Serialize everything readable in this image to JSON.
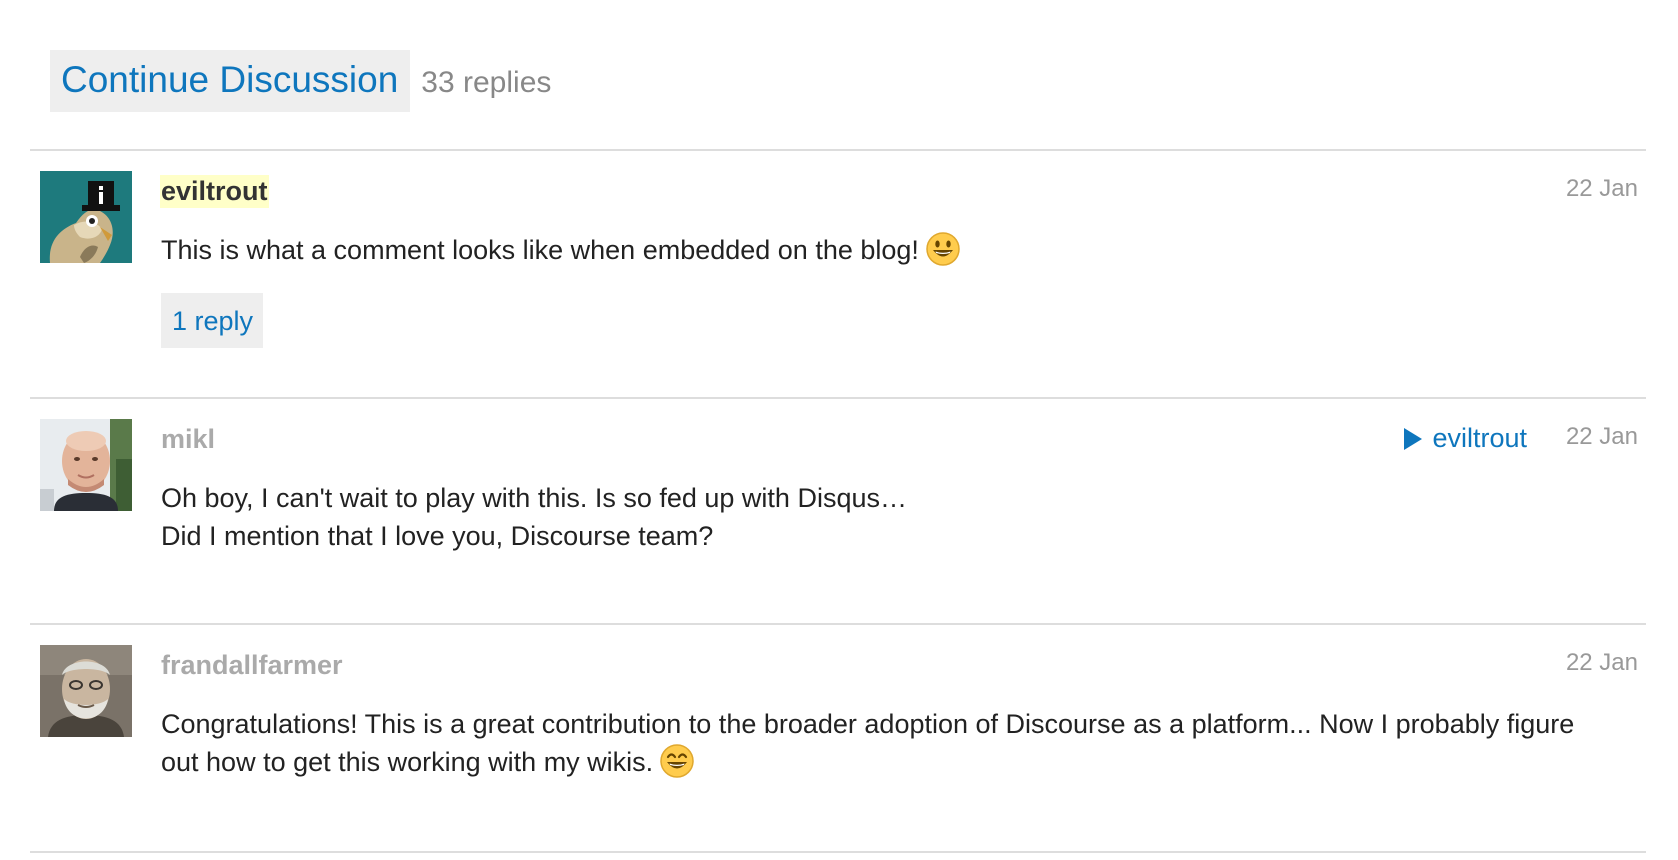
{
  "header": {
    "continue_label": "Continue Discussion",
    "replies_count": "33 replies"
  },
  "posts": [
    {
      "username": "eviltrout",
      "date": "22 Jan",
      "body_lines": [
        "This is what a comment looks like when embedded on the blog!"
      ],
      "emoji": "smiley",
      "reply_label": "1 reply",
      "avatar_icon": "owl-top-hat-avatar"
    },
    {
      "username": "mikl",
      "date": "22 Jan",
      "reply_to": "eviltrout",
      "body_lines": [
        "Oh boy, I can't wait to play with this. Is so fed up with Disqus…",
        "Did I mention that I love you, Discourse team?"
      ],
      "avatar_icon": "man-photo-avatar"
    },
    {
      "username": "frandallfarmer",
      "date": "22 Jan",
      "body_lines": [
        "Congratulations! This is a great contribution to the broader adoption of Discourse as a platform... Now I probably figure",
        "out how to get this working with my wikis."
      ],
      "emoji": "smile",
      "avatar_icon": "bearded-man-photo-avatar"
    }
  ],
  "colors": {
    "link": "#0e76bd",
    "button_bg": "#eeeeee",
    "highlight": "#ffffc8",
    "divider": "#dddddd",
    "muted": "#999999"
  }
}
